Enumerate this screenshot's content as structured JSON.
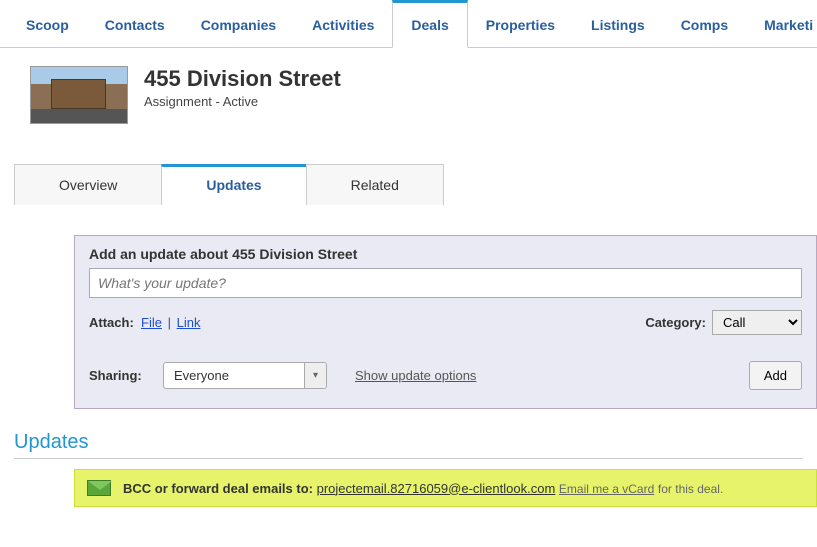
{
  "nav": {
    "tabs": [
      "Scoop",
      "Contacts",
      "Companies",
      "Activities",
      "Deals",
      "Properties",
      "Listings",
      "Comps",
      "Marketi"
    ],
    "active": "Deals"
  },
  "deal": {
    "title": "455 Division Street",
    "subtitle": "Assignment - Active"
  },
  "subtabs": {
    "items": [
      "Overview",
      "Updates",
      "Related"
    ],
    "active": "Updates"
  },
  "updateForm": {
    "heading": "Add an update about 455 Division Street",
    "placeholder": "What's your update?",
    "attach_label": "Attach:",
    "attach_file": "File",
    "attach_link": "Link",
    "category_label": "Category:",
    "category_value": "Call",
    "sharing_label": "Sharing:",
    "sharing_value": "Everyone",
    "show_options": "Show update options",
    "add_button": "Add"
  },
  "updatesSection": {
    "title": "Updates",
    "bcc_prefix": "BCC or forward deal emails to:",
    "bcc_email": "projectemail.82716059@e-clientlook.com",
    "vcard_link": "Email me a vCard",
    "vcard_tail": "for this deal."
  }
}
